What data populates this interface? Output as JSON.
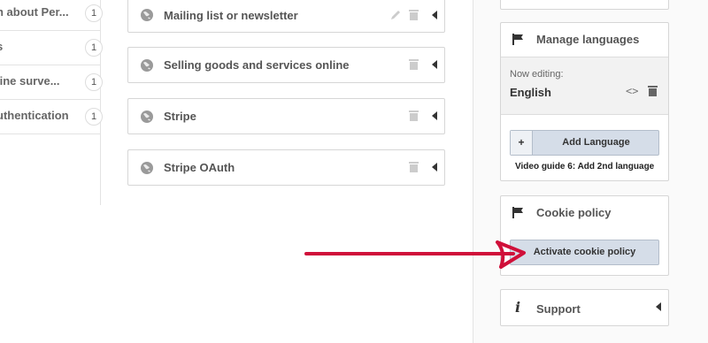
{
  "left_list": {
    "items": [
      {
        "label": "n about Per...",
        "count": "1"
      },
      {
        "label": "s",
        "count": "1"
      },
      {
        "label": "line surve...",
        "count": "1"
      },
      {
        "label": "uthentication",
        "count": "1"
      }
    ]
  },
  "panels": [
    {
      "title": "Mailing list or newsletter"
    },
    {
      "title": "Selling goods and services online"
    },
    {
      "title": "Stripe"
    },
    {
      "title": "Stripe OAuth"
    }
  ],
  "sidebar": {
    "manage_languages": {
      "title": "Manage languages",
      "now_editing_label": "Now editing:",
      "current_language": "English",
      "add_language_plus": "+",
      "add_language_label": "Add Language",
      "video_guide": "Video guide 6: Add 2nd language"
    },
    "cookie_policy": {
      "title": "Cookie policy",
      "activate_label": "Activate cookie policy"
    },
    "support": {
      "icon_glyph": "i",
      "title": "Support"
    }
  },
  "colors": {
    "arrow": "#d0103a",
    "button_bg": "#d5dde8"
  },
  "icons": [
    "globe-icon",
    "pencil-icon",
    "trash-icon",
    "caret-left-icon",
    "flag-icon",
    "code-icon",
    "info-icon"
  ]
}
